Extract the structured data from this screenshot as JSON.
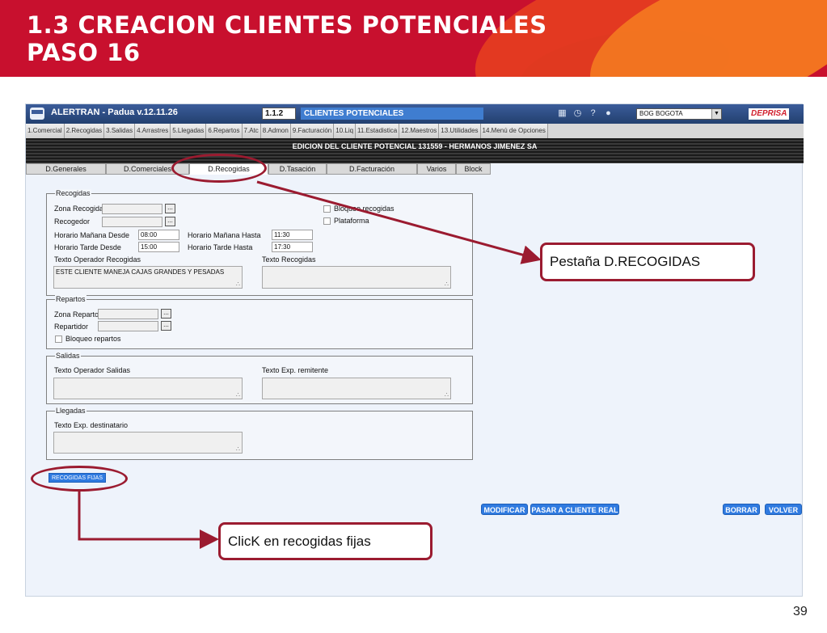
{
  "slide": {
    "title_line1": "1.3 CREACION CLIENTES POTENCIALES",
    "title_line2": "PASO 16",
    "page_number": "39"
  },
  "app": {
    "title": "ALERTRAN - Padua  v.12.11.26",
    "screen_code": "1.1.2",
    "screen_title": "CLIENTES POTENCIALES",
    "city_select": "BOG BOGOTA",
    "logo": "DEPRISA",
    "menu": [
      "1.Comercial",
      "2.Recogidas",
      "3.Salidas",
      "4.Arrastres",
      "5.Llegadas",
      "6.Repartos",
      "7.Atc",
      "8.Admon",
      "9.Facturación",
      "10.Liq",
      "11.Estadistica",
      "12.Maestros",
      "13.Utilidades",
      "14.Menú de Opciones"
    ],
    "edit_title": "EDICION DEL CLIENTE POTENCIAL 131559 - HERMANOS JIMENEZ SA",
    "tabs": [
      "D.Generales",
      "D.Comerciales",
      "D.Recogidas",
      "D.Tasación",
      "D.Facturación",
      "Varios",
      "Block"
    ],
    "active_tab": "D.Recogidas"
  },
  "recogidas": {
    "legend": "Recogidas",
    "zona_label": "Zona Recogida",
    "zona_value": "",
    "recogedor_label": "Recogedor",
    "recogedor_value": "",
    "bloqueo_label": "Bloqueo recogidas",
    "plataforma_label": "Plataforma",
    "manana_desde_label": "Horario Mañana Desde",
    "manana_desde_value": "08:00",
    "manana_hasta_label": "Horario Mañana Hasta",
    "manana_hasta_value": "11:30",
    "tarde_desde_label": "Horario Tarde Desde",
    "tarde_desde_value": "15:00",
    "tarde_hasta_label": "Horario Tarde Hasta",
    "tarde_hasta_value": "17:30",
    "texto_operador_label": "Texto Operador Recogidas",
    "texto_operador_value": "ESTE CLIENTE MANEJA CAJAS GRANDES Y PESADAS",
    "texto_recogidas_label": "Texto Recogidas",
    "texto_recogidas_value": ""
  },
  "repartos": {
    "legend": "Repartos",
    "zona_label": "Zona Reparto",
    "repartidor_label": "Repartidor",
    "bloqueo_label": "Bloqueo repartos"
  },
  "salidas": {
    "legend": "Salidas",
    "texto_operador_label": "Texto Operador Salidas",
    "texto_remitente_label": "Texto Exp. remitente"
  },
  "llegadas": {
    "legend": "Llegadas",
    "texto_destinatario_label": "Texto Exp. destinatario"
  },
  "buttons": {
    "dots": "...",
    "recogidas_fijas": "RECOGIDAS FIJAS",
    "modificar": "MODIFICAR",
    "pasar": "PASAR A CLIENTE REAL",
    "borrar": "BORRAR",
    "volver": "VOLVER"
  },
  "callouts": {
    "pestana": "Pestaña D.RECOGIDAS",
    "click": "ClicK en recogidas fijas"
  },
  "colors": {
    "banner": "#c8102e",
    "annotation": "#9b1b30",
    "button_blue": "#2f7ae0"
  }
}
